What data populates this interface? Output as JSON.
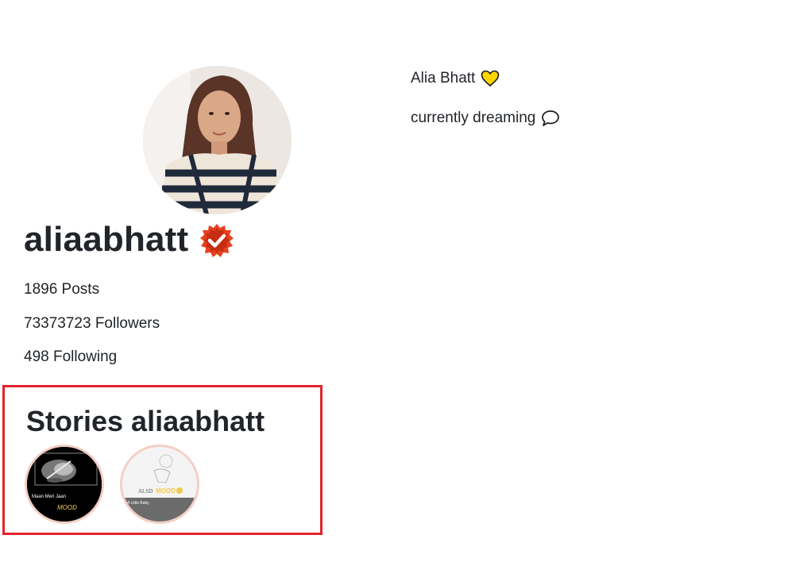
{
  "profile": {
    "username": "aliaabhatt",
    "posts": "1896 Posts",
    "followers": "73373723 Followers",
    "following": "498 Following",
    "avatar_icon": "profile-photo",
    "verified_icon": "verified-badge-icon"
  },
  "bio": {
    "name": "Alia Bhatt",
    "name_icon": "yellow-heart-icon",
    "status": "currently dreaming",
    "status_icon": "speech-bubble-icon"
  },
  "stories": {
    "title": "Stories aliaabhatt",
    "items": [
      {
        "caption": "Maan Meri Jaan",
        "mood": "MOOD"
      },
      {
        "caption": "A Little Baby",
        "mood": "MOOD",
        "tag": "ALSD"
      }
    ]
  },
  "colors": {
    "text": "#212529",
    "highlight_border": "#e2232d",
    "verified_red": "#e8411f",
    "heart_yellow": "#ffd600",
    "story_ring": "#f3cfc4"
  }
}
